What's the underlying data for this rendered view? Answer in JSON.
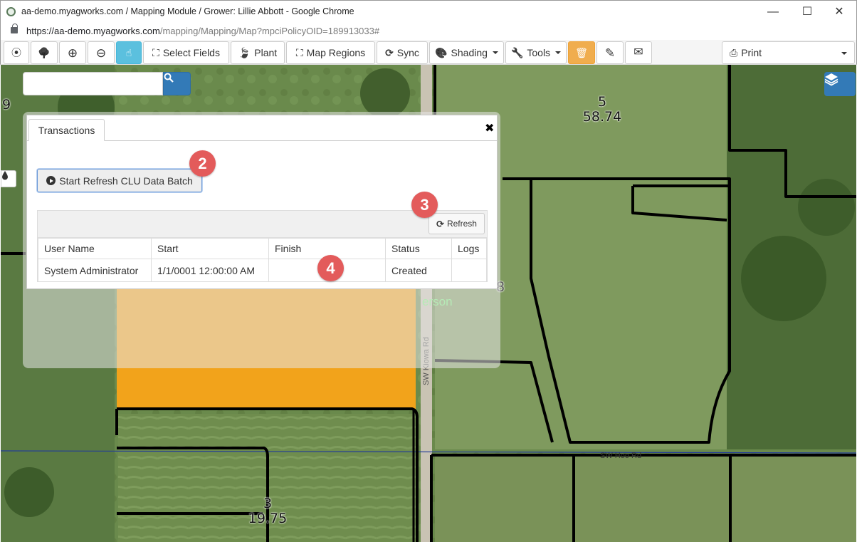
{
  "window": {
    "title": "aa-demo.myagworks.com / Mapping Module / Grower: Lillie Abbott - Google Chrome",
    "url_host": "https://aa-demo.myagworks.com",
    "url_path": "/mapping/Mapping/Map?mpciPolicyOID=189913033#",
    "controls": {
      "minimize": "—",
      "maximize": "☐",
      "close": "✕"
    }
  },
  "toolbar": {
    "locate_icon": "⦿",
    "tree_icon": "🌳",
    "zoom_in_icon": "⊕",
    "zoom_out_icon": "⊖",
    "select_icon": "☝",
    "select_fields_label": "Select Fields",
    "select_fields_icon": "⛶",
    "plant_label": "Plant",
    "plant_icon": "🍃",
    "map_regions_label": "Map Regions",
    "map_regions_icon": "⛶",
    "sync_label": "Sync",
    "sync_icon": "⟳",
    "shading_label": "Shading",
    "shading_icon": "🎨",
    "tools_label": "Tools",
    "tools_icon": "🔧",
    "delete_icon": "🗑",
    "edit_icon": "✎",
    "mail_icon": "✉",
    "print_label": "Print",
    "print_icon": "⎙"
  },
  "map": {
    "search_placeholder": "",
    "field_labels": [
      {
        "id": "5",
        "acres": "58.74"
      },
      {
        "id": "3",
        "acres": "19.75"
      },
      {
        "id": "9",
        "acres": ""
      }
    ],
    "road_labels": [
      "SW Kiowa Rd",
      "SW Hoo Rd"
    ],
    "overlay_text": "erson",
    "partial_label": "8",
    "colors": {
      "selected_field": "#f2a31b",
      "boundary": "#000000",
      "accent": "#337ab7"
    }
  },
  "panel": {
    "tab_label": "Transactions",
    "close_icon": "✖",
    "start_button_label": "Start Refresh CLU Data Batch",
    "refresh_button_label": "Refresh",
    "columns": [
      "User Name",
      "Start",
      "Finish",
      "Status",
      "Logs"
    ],
    "rows": [
      {
        "user": "System Administrator",
        "start": "1/1/0001 12:00:00 AM",
        "finish": "",
        "status": "Created",
        "logs": ""
      }
    ]
  },
  "callouts": [
    "2",
    "3",
    "4"
  ]
}
